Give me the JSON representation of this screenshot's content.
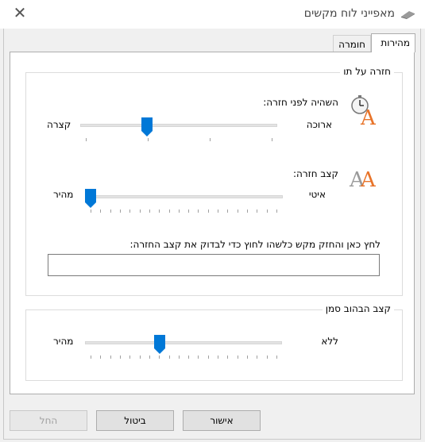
{
  "window": {
    "title": "מאפייני לוח מקשים",
    "close_glyph": "✕"
  },
  "tabs": [
    {
      "label": "מהירות",
      "active": true
    },
    {
      "label": "חומרה",
      "active": false
    }
  ],
  "repeat_group": {
    "title": "חזרה על תו",
    "delay": {
      "label": "השהיה לפני חזרה:",
      "left_label": "קצרה",
      "right_label": "ארוכה",
      "value_fraction": 0.33
    },
    "rate": {
      "label": "קצב חזרה:",
      "left_label": "מהיר",
      "right_label": "איטי",
      "value_fraction": 0.0
    },
    "test": {
      "label": "לחץ כאן והחזק מקש כלשהו לחוץ כדי לבדוק את קצב החזרה:",
      "value": ""
    }
  },
  "blink_group": {
    "title": "קצב הבהוב סמן",
    "left_label": "מהיר",
    "right_label": "ללא",
    "value_fraction": 0.37
  },
  "buttons": {
    "ok": "אישור",
    "cancel": "ביטול",
    "apply": "החל"
  },
  "colors": {
    "accent": "#0078d7",
    "icon_orange": "#e8742a",
    "icon_gray": "#9a9a9a"
  },
  "icons": {
    "title": "keyboard-icon",
    "delay": "stopwatch-a-icon",
    "rate": "double-a-icon"
  }
}
